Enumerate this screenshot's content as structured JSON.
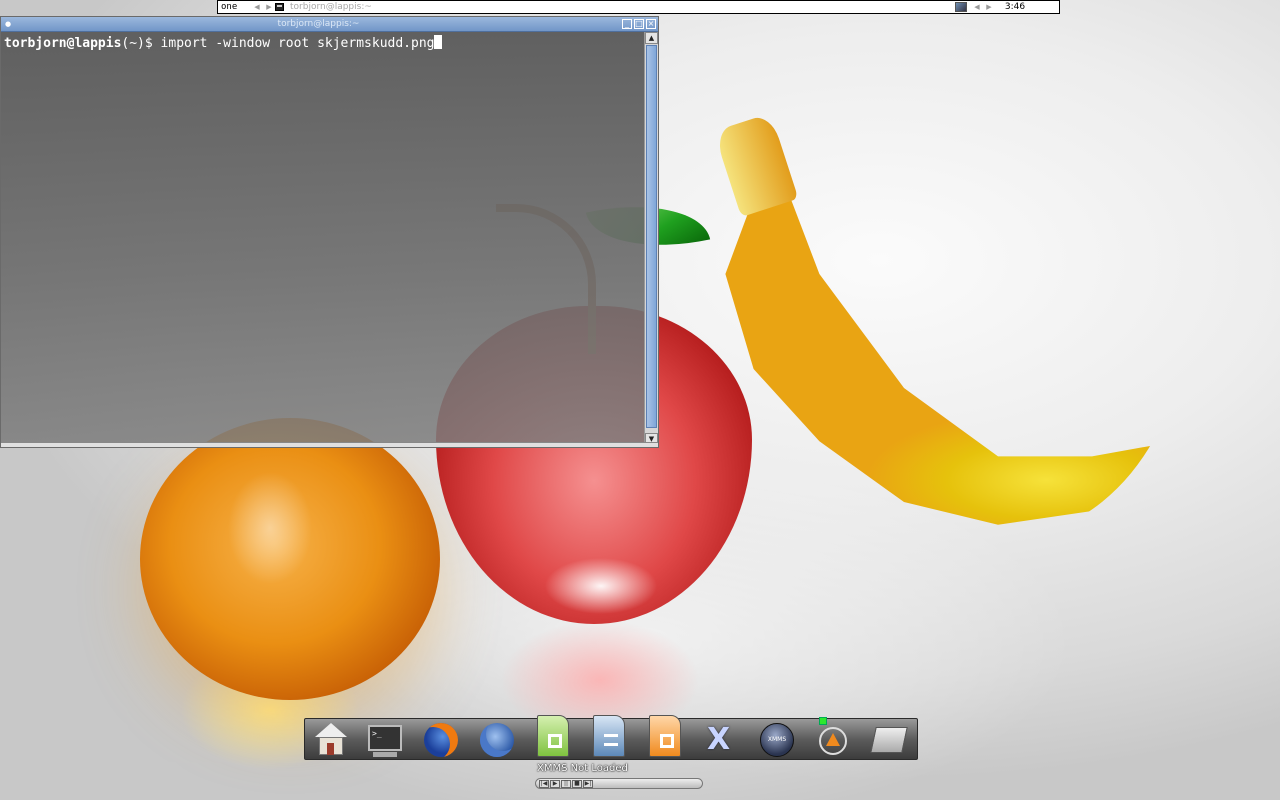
{
  "panel": {
    "workspace": "one",
    "task_title": "torbjorn@lappis:~",
    "clock": "3:46"
  },
  "terminal": {
    "title": "torbjorn@lappis:~",
    "prompt": "torbjorn@lappis",
    "cwd": "(~)$ ",
    "command": "import -window root skjermskudd.png"
  },
  "dock": {
    "xmms_icon_label": "XMMS",
    "terminal_screen_text": ">_"
  },
  "xmms": {
    "status": "XMMS Not Loaded",
    "controls": [
      "|◀",
      "▶",
      "||",
      "■",
      "▶|"
    ]
  },
  "colors": {
    "title_bar": "#7196c8",
    "terminal_bg": "#5c5c5c"
  }
}
